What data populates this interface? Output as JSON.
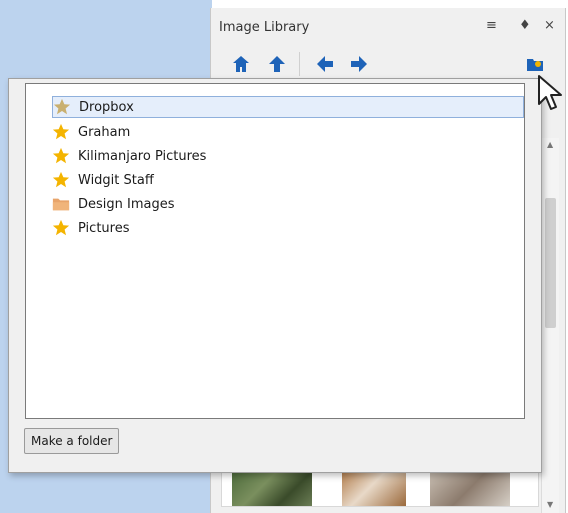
{
  "panel": {
    "title": "Image Library",
    "menu_icon": "≡",
    "pin_icon": "♦",
    "close_icon": "×"
  },
  "nav": {
    "home": "home-icon",
    "up": "arrow-up-icon",
    "back": "arrow-left-icon",
    "forward": "arrow-right-icon",
    "folder": "folder-icon"
  },
  "popup": {
    "items": [
      {
        "label": "Dropbox",
        "icon": "star-icon",
        "selected": true
      },
      {
        "label": "Graham",
        "icon": "star-icon"
      },
      {
        "label": "Kilimanjaro Pictures",
        "icon": "star-icon"
      },
      {
        "label": "Widgit Staff",
        "icon": "star-icon"
      },
      {
        "label": "Design Images",
        "icon": "folder-icon"
      },
      {
        "label": "Pictures",
        "icon": "star-icon"
      }
    ],
    "make_folder_label": "Make a folder"
  },
  "colors": {
    "accent": "#1e63b8",
    "star": "#f4b400",
    "folder": "#e8a46a",
    "selection": "#e5eefb"
  }
}
